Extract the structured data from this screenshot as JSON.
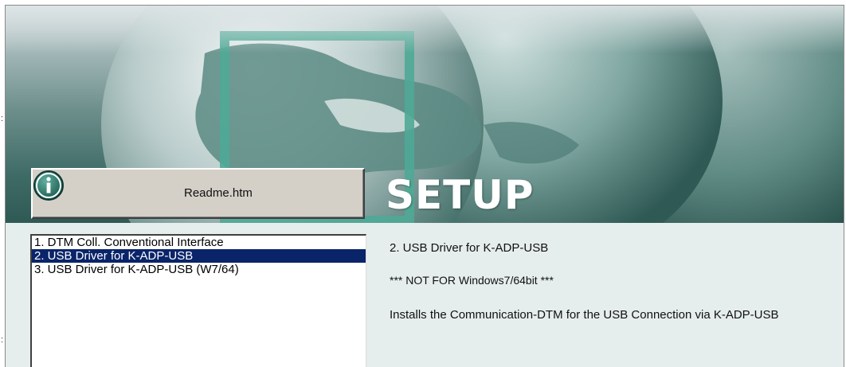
{
  "banner": {
    "title": "SETUP",
    "readme_button": {
      "label": "Readme.htm",
      "icon": "info-icon"
    }
  },
  "list": {
    "items": [
      {
        "label": "1. DTM Coll. Conventional Interface",
        "selected": false
      },
      {
        "label": "2. USB Driver for K-ADP-USB",
        "selected": true
      },
      {
        "label": "3. USB Driver for K-ADP-USB (W7/64)",
        "selected": false
      }
    ]
  },
  "detail": {
    "title": "2. USB Driver for K-ADP-USB",
    "warning": "*** NOT FOR Windows7/64bit ***",
    "description": "Installs the Communication-DTM for the USB Connection via K-ADP-USB"
  },
  "colors": {
    "selection": "#0a246a",
    "accent_frame": "#4fa896",
    "button_face": "#d4d0c8"
  }
}
